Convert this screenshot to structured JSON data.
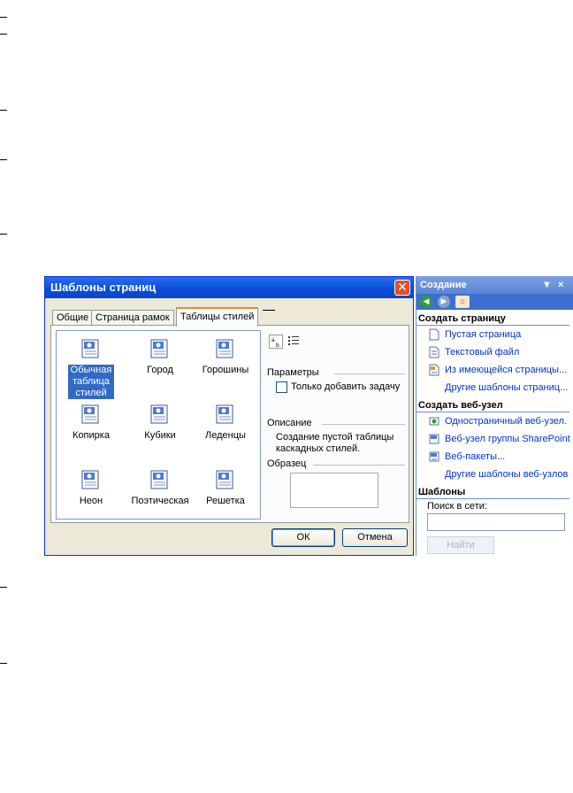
{
  "dialog": {
    "title": "Шаблоны страниц",
    "close_symbol": "✕",
    "tabs": [
      {
        "label": "Общие",
        "active": false
      },
      {
        "label": "Страница рамок",
        "active": false
      },
      {
        "label": "Таблицы стилей",
        "active": true
      }
    ],
    "templates": [
      {
        "label": "Обычная таблица стилей",
        "selected": true,
        "icon": "stylesheet-icon"
      },
      {
        "label": "Город",
        "selected": false,
        "icon": "stylesheet-icon"
      },
      {
        "label": "Горошины",
        "selected": false,
        "icon": "stylesheet-icon"
      },
      {
        "label": "Копирка",
        "selected": false,
        "icon": "stylesheet-icon"
      },
      {
        "label": "Кубики",
        "selected": false,
        "icon": "stylesheet-icon"
      },
      {
        "label": "Леденцы",
        "selected": false,
        "icon": "stylesheet-icon"
      },
      {
        "label": "Неон",
        "selected": false,
        "icon": "stylesheet-icon"
      },
      {
        "label": "Поэтическая",
        "selected": false,
        "icon": "stylesheet-icon"
      },
      {
        "label": "Решетка",
        "selected": false,
        "icon": "stylesheet-icon"
      }
    ],
    "params_label": "Параметры",
    "only_task_label": "Только добавить задачу",
    "only_task_checked": false,
    "description_label": "Описание",
    "description_text": "Создание пустой таблицы каскадных стилей.",
    "sample_label": "Образец",
    "ok_label": "ОК",
    "cancel_label": "Отмена"
  },
  "pane": {
    "title": "Создание",
    "dropdown_symbol": "▼",
    "close_symbol": "×",
    "section_create_page": "Создать страницу",
    "page_links": [
      {
        "label": "Пустая страница",
        "icon": "blank-page-icon"
      },
      {
        "label": "Текстовый файл",
        "icon": "text-file-icon"
      },
      {
        "label": "Из имеющейся страницы...",
        "icon": "existing-page-icon"
      },
      {
        "label": "Другие шаблоны страниц...",
        "icon": ""
      }
    ],
    "section_create_site": "Создать веб-узел",
    "site_links": [
      {
        "label": "Одностраничный веб-узел.",
        "icon": "single-page-site-icon"
      },
      {
        "label": "Веб-узел группы SharePoint",
        "icon": "sharepoint-site-icon"
      },
      {
        "label": "Веб-пакеты...",
        "icon": "web-package-icon"
      },
      {
        "label": "Другие шаблоны веб-узлов",
        "icon": ""
      }
    ],
    "section_templates": "Шаблоны",
    "search_label": "Поиск в сети:",
    "search_value": "",
    "find_label": "Найти"
  },
  "colors": {
    "xp_title_blue": "#0a4fd8",
    "selection_blue": "#316ac5",
    "link_blue": "#0033cc",
    "dialog_face": "#ece9d8"
  }
}
